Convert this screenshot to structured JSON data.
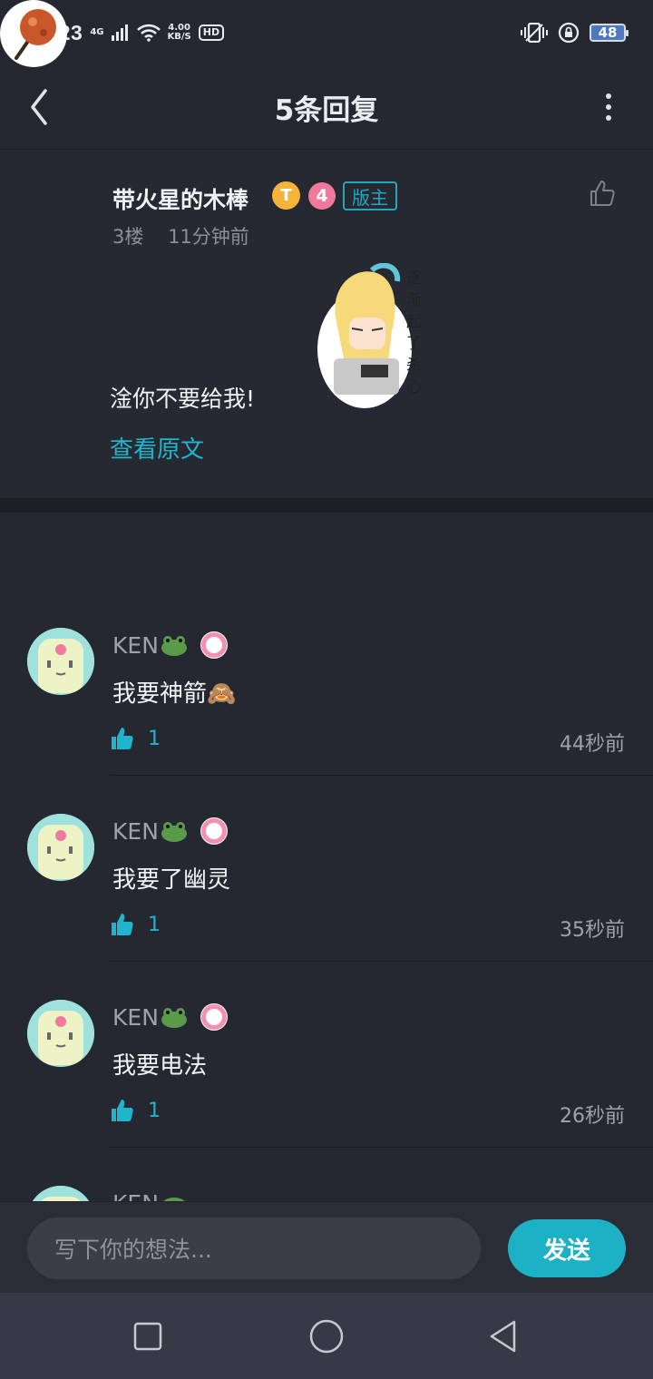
{
  "status_bar": {
    "time": "15:23",
    "network": "4G",
    "speed_top": "4.00",
    "speed_bottom": "KB/S",
    "hd": "HD",
    "battery": "48"
  },
  "nav": {
    "title": "5条回复"
  },
  "floor": {
    "user_name": "带火星的木棒",
    "t_badge": "T",
    "level": "4",
    "role_badge": "版主",
    "floor_number": "3楼",
    "posted_time": "11分钟前",
    "content": "淦你不要给我!",
    "sticker_text": "逐渐起了杀心...",
    "view_original": "查看原文"
  },
  "replies": [
    {
      "user": "KEN",
      "content": "我要神箭🙈",
      "likes": "1",
      "time": "44秒前"
    },
    {
      "user": "KEN",
      "content": "我要了幽灵",
      "likes": "1",
      "time": "35秒前"
    },
    {
      "user": "KEN",
      "content": "我要电法",
      "likes": "1",
      "time": "26秒前"
    },
    {
      "user": "KEN",
      "content": "",
      "likes": "",
      "time": ""
    }
  ],
  "composer": {
    "placeholder": "写下你的想法...",
    "send_label": "发送"
  },
  "colors": {
    "background": "#252831",
    "accent": "#1fb5cc",
    "level_badge": "#ef7a9d",
    "t_badge": "#f4b43a"
  },
  "icons": [
    "back-arrow-icon",
    "more-vert-icon",
    "thumb-up-outline-icon",
    "thumb-up-filled-icon",
    "frog-emoji-icon",
    "square-nav-icon",
    "circle-nav-icon",
    "triangle-back-icon"
  ]
}
